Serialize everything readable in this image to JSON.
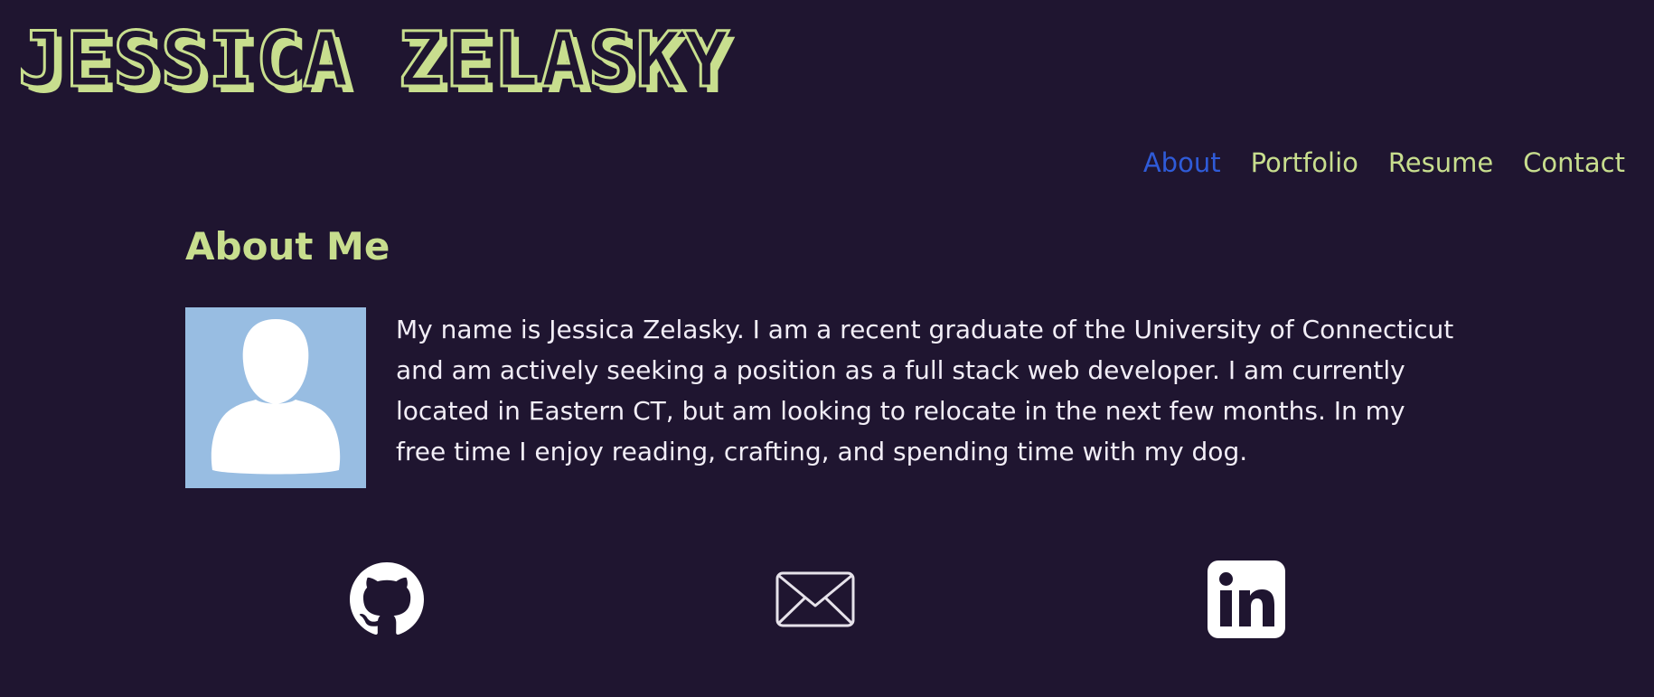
{
  "header": {
    "title": "JESSICA ZELASKY"
  },
  "nav": {
    "items": [
      {
        "label": "About",
        "active": true
      },
      {
        "label": "Portfolio",
        "active": false
      },
      {
        "label": "Resume",
        "active": false
      },
      {
        "label": "Contact",
        "active": false
      }
    ]
  },
  "about": {
    "heading": "About Me",
    "avatar_icon": "user-silhouette-icon",
    "bio": "My name is Jessica Zelasky. I am a recent graduate of the University of Connecticut and am actively seeking a position as a full stack web developer. I am currently located in Eastern CT, but am looking to relocate in the next few months. In my free time I enjoy reading, crafting, and spending time with my dog."
  },
  "social": {
    "items": [
      {
        "icon": "github-icon"
      },
      {
        "icon": "email-icon"
      },
      {
        "icon": "linkedin-icon"
      }
    ]
  },
  "colors": {
    "background": "#1f1530",
    "accent": "#c8de8e",
    "active_link": "#2f5bd8",
    "text": "#f2eef7",
    "avatar_bg": "#98bde2"
  }
}
